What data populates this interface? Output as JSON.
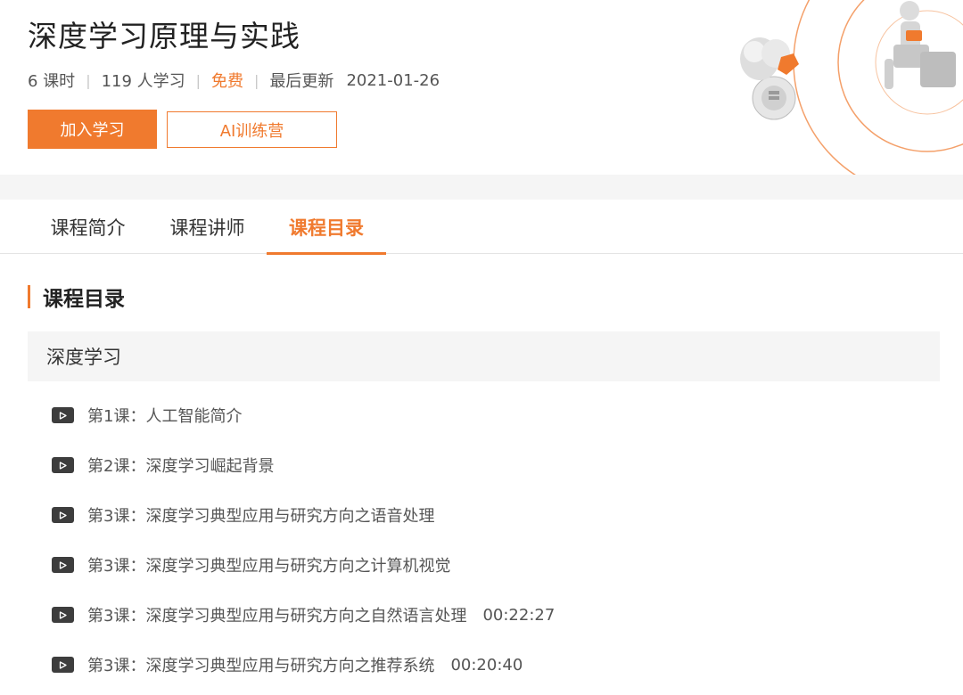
{
  "course": {
    "title": "深度学习原理与实践",
    "lessons_count": "6 课时",
    "learners": "119 人学习",
    "price": "免费",
    "updated_label": "最后更新",
    "updated_date": "2021-01-26",
    "join_label": "加入学习",
    "ai_camp_label": "AI训练营"
  },
  "tabs": [
    {
      "label": "课程简介"
    },
    {
      "label": "课程讲师"
    },
    {
      "label": "课程目录",
      "active": true
    }
  ],
  "catalog": {
    "heading": "课程目录",
    "chapter": "深度学习",
    "lessons": [
      {
        "title": "第1课：人工智能简介",
        "duration": ""
      },
      {
        "title": "第2课：深度学习崛起背景",
        "duration": ""
      },
      {
        "title": "第3课：深度学习典型应用与研究方向之语音处理",
        "duration": ""
      },
      {
        "title": "第3课：深度学习典型应用与研究方向之计算机视觉",
        "duration": ""
      },
      {
        "title": "第3课：深度学习典型应用与研究方向之自然语言处理",
        "duration": "00:22:27"
      },
      {
        "title": "第3课：深度学习典型应用与研究方向之推荐系统",
        "duration": "00:20:40"
      }
    ]
  },
  "colors": {
    "accent": "#f07a2e",
    "text": "#333333",
    "muted": "#555555",
    "band": "#f5f5f5",
    "play_icon_bg": "#3d3d3d"
  },
  "icons": [
    "play-icon",
    "robot-illustration"
  ]
}
